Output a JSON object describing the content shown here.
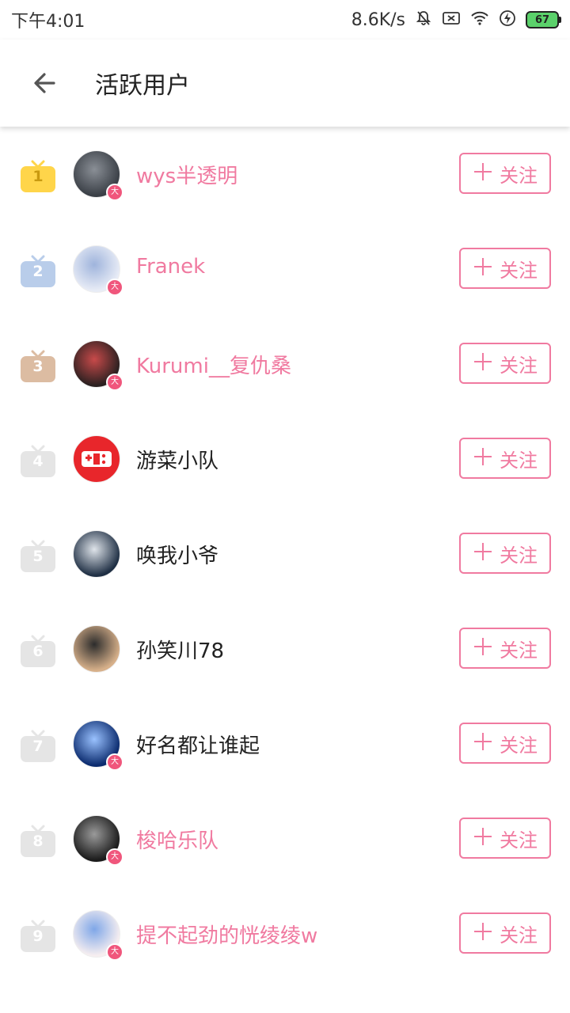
{
  "status_bar": {
    "time": "下午4:01",
    "net_speed": "8.6K/s",
    "battery": "67"
  },
  "app_bar": {
    "title": "活跃用户"
  },
  "follow_label": "关注",
  "users": [
    {
      "rank": "1",
      "name": "wys半透明",
      "name_color": "pink",
      "badge_color": "#ffd54a",
      "verified": true,
      "avatar_colors": [
        "#3a3f46",
        "#8a8f96"
      ]
    },
    {
      "rank": "2",
      "name": "Franek",
      "name_color": "pink",
      "badge_color": "#b9cdea",
      "verified": true,
      "avatar_colors": [
        "#e8ecf6",
        "#9fb4dc"
      ]
    },
    {
      "rank": "3",
      "name": "Kurumi__复仇桑",
      "name_color": "pink",
      "badge_color": "#dcbca2",
      "verified": true,
      "avatar_colors": [
        "#2a2020",
        "#c84a4a"
      ]
    },
    {
      "rank": "4",
      "name": "游菜小队",
      "name_color": "dark",
      "badge_color": "#e5e5e5",
      "verified": false,
      "avatar_colors": [
        "#e8262b",
        "#ffffff"
      ]
    },
    {
      "rank": "5",
      "name": "唤我小爷",
      "name_color": "dark",
      "badge_color": "#e5e5e5",
      "verified": false,
      "avatar_colors": [
        "#1f2f44",
        "#dfe4ea"
      ]
    },
    {
      "rank": "6",
      "name": "孙笑川78",
      "name_color": "dark",
      "badge_color": "#e5e5e5",
      "verified": false,
      "avatar_colors": [
        "#d7b08a",
        "#2c2c2c"
      ]
    },
    {
      "rank": "7",
      "name": "好名都让谁起",
      "name_color": "dark",
      "badge_color": "#e5e5e5",
      "verified": true,
      "avatar_colors": [
        "#0b2b6e",
        "#9ac2ff"
      ]
    },
    {
      "rank": "8",
      "name": "梭哈乐队",
      "name_color": "pink",
      "badge_color": "#e5e5e5",
      "verified": true,
      "avatar_colors": [
        "#1a1a1a",
        "#9a9a9a"
      ]
    },
    {
      "rank": "9",
      "name": "提不起劲的恍绫绫w",
      "name_color": "pink",
      "badge_color": "#e5e5e5",
      "verified": true,
      "avatar_colors": [
        "#f6eef0",
        "#7fa7e8"
      ]
    }
  ]
}
